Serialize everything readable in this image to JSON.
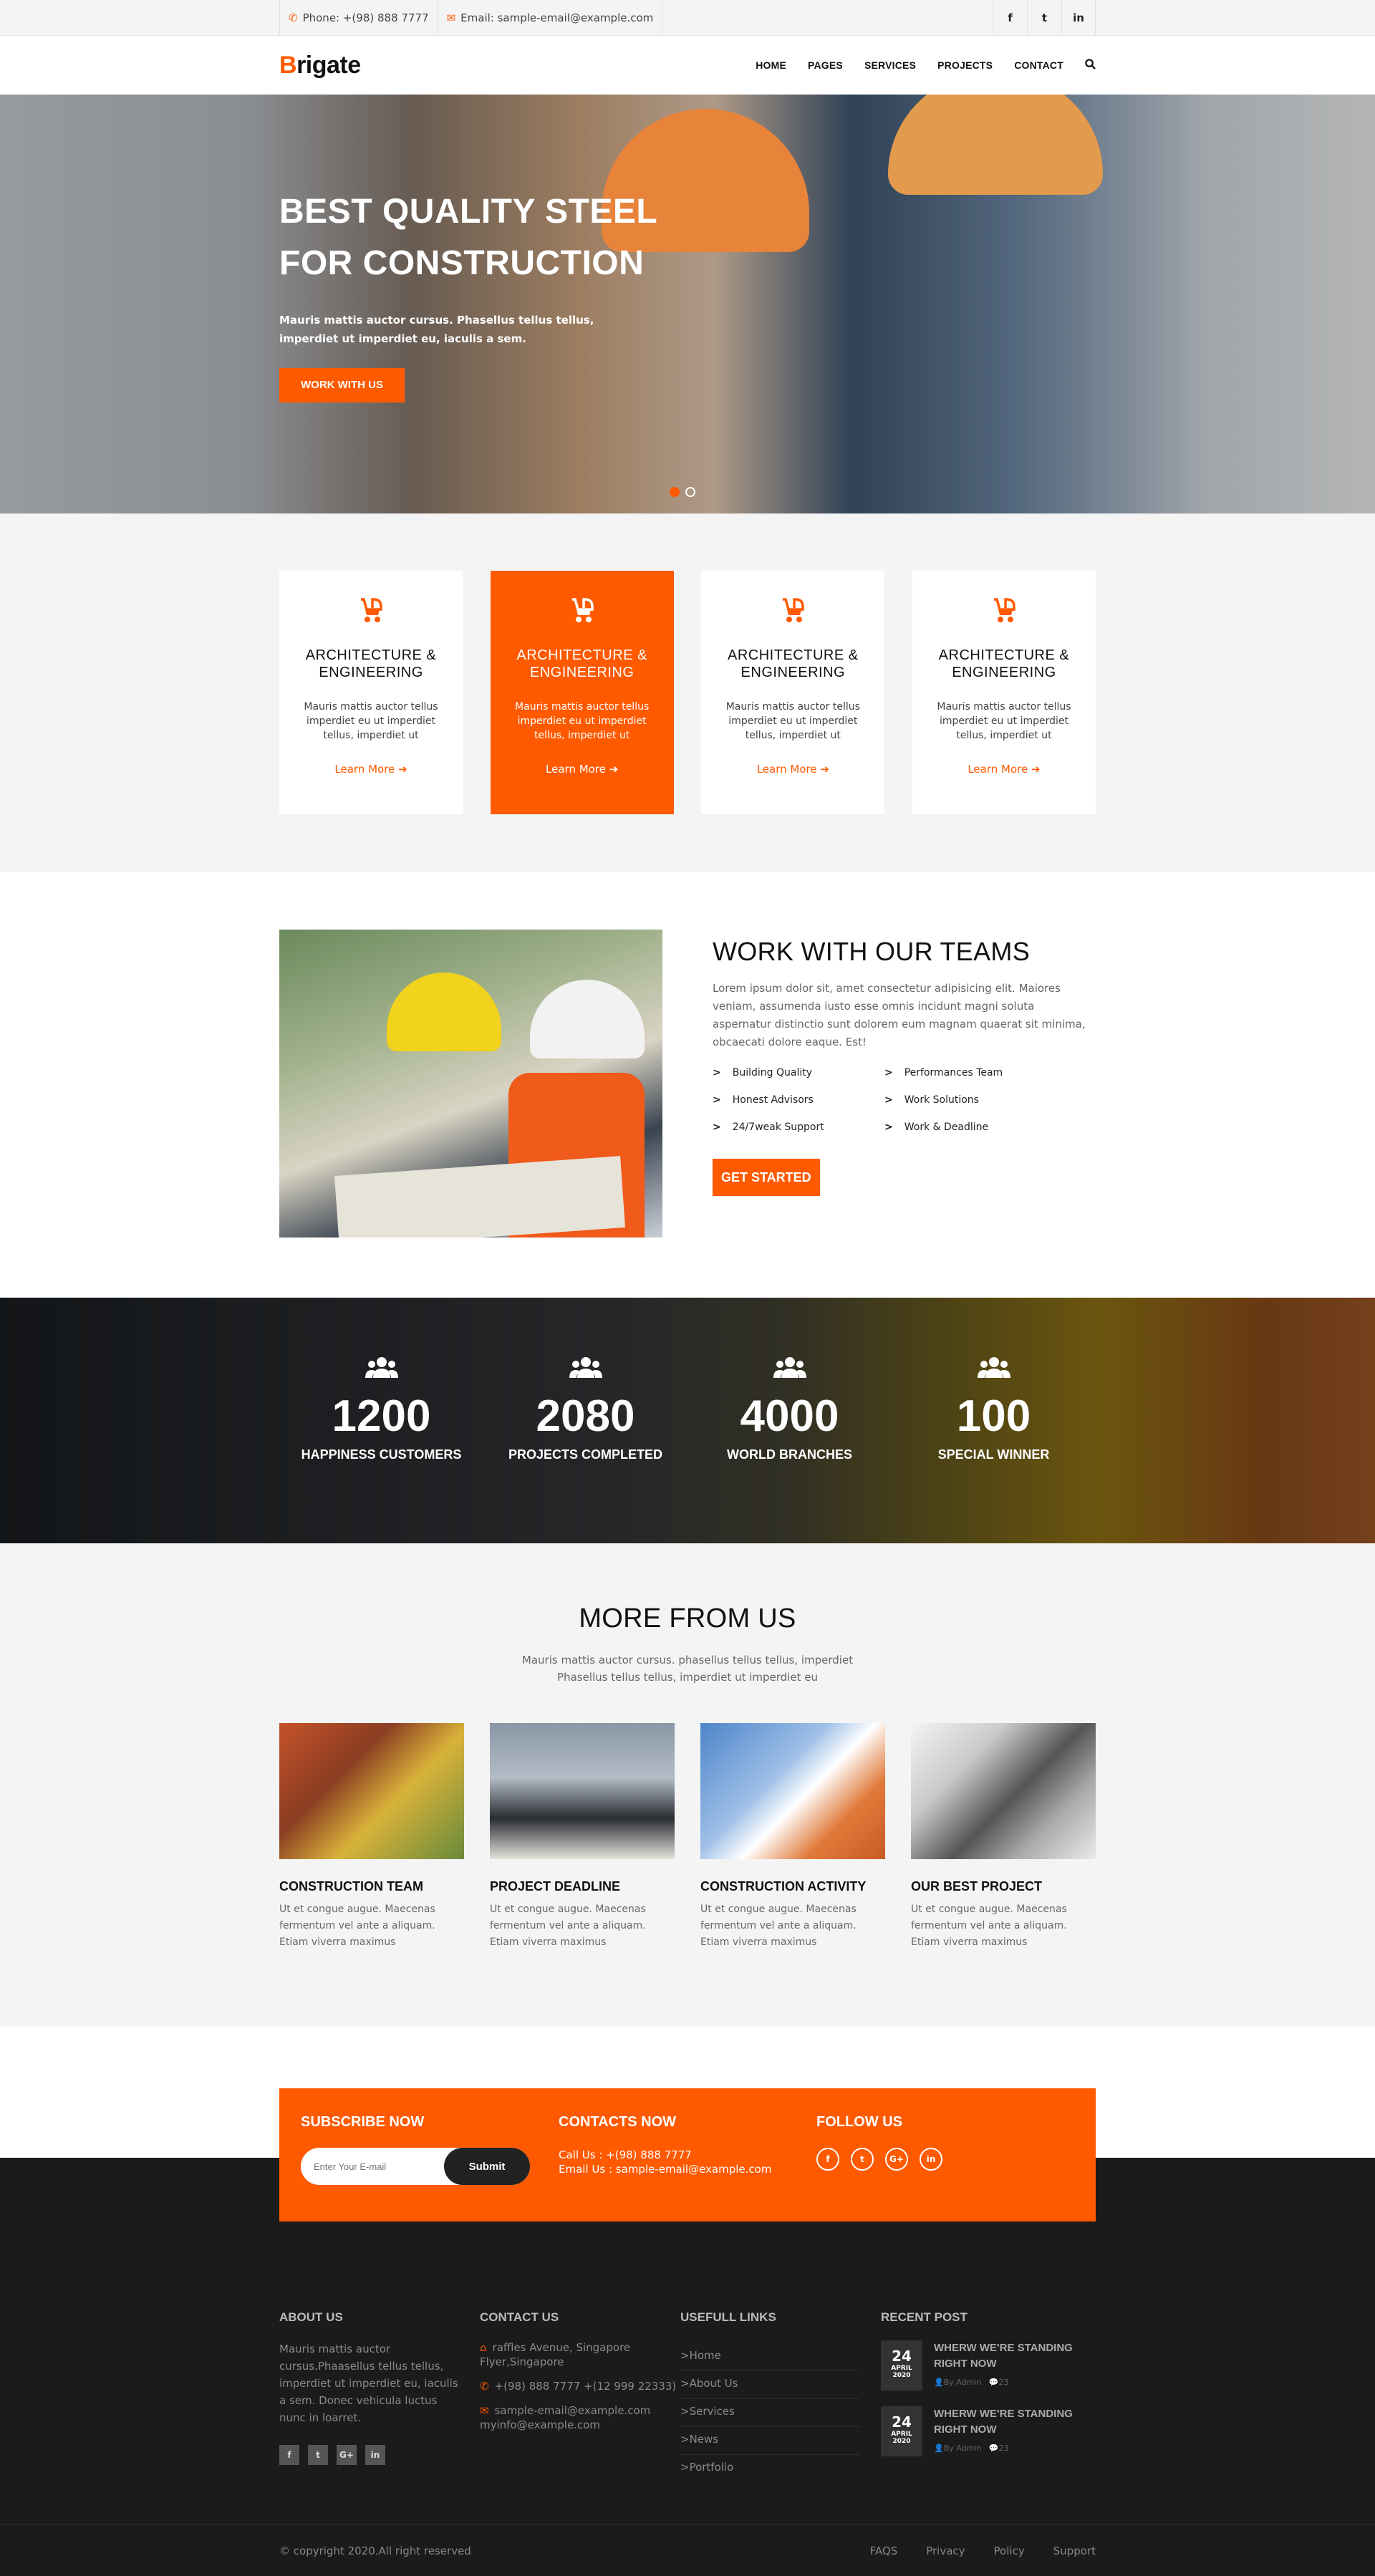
{
  "topbar": {
    "phone": "Phone: +(98) 888 7777",
    "email": "Email: sample-email@example.com",
    "socials": [
      "f",
      "t",
      "in"
    ]
  },
  "header": {
    "logo_first": "B",
    "logo_rest": "rigate",
    "nav": [
      "HOME",
      "PAGES",
      "SERVICES",
      "PROJECTS",
      "CONTACT"
    ]
  },
  "hero": {
    "title": "BEST QUALITY STEEL FOR CONSTRUCTION",
    "text": "Mauris mattis auctor cursus. Phasellus tellus tellus, imperdiet ut imperdiet eu, iaculis a sem.",
    "button": "WORK WITH US"
  },
  "services": [
    {
      "title": "ARCHITECTURE & ENGINEERING",
      "text": "Mauris mattis auctor tellus imperdiet eu ut imperdiet tellus, imperdiet ut",
      "link": "Learn More"
    },
    {
      "title": "ARCHITECTURE & ENGINEERING",
      "text": "Mauris mattis auctor tellus imperdiet eu ut imperdiet tellus, imperdiet ut",
      "link": "Learn More"
    },
    {
      "title": "ARCHITECTURE & ENGINEERING",
      "text": "Mauris mattis auctor tellus imperdiet eu ut imperdiet tellus, imperdiet ut",
      "link": "Learn More"
    },
    {
      "title": "ARCHITECTURE & ENGINEERING",
      "text": "Mauris mattis auctor tellus imperdiet eu ut imperdiet tellus, imperdiet ut",
      "link": "Learn More"
    }
  ],
  "team": {
    "title": "WORK WITH OUR TEAMS",
    "text": "Lorem ipsum dolor sit, amet consectetur adipisicing elit. Maiores veniam, assumenda iusto esse omnis incidunt magni soluta aspernatur distinctio sunt dolorem eum magnam quaerat sit minima, obcaecati dolore eaque. Est!",
    "items": [
      "Building Quality",
      "Performances Team",
      "Honest Advisors",
      "Work Solutions",
      "24/7weak Support",
      "Work & Deadline"
    ],
    "button": "GET STARTED"
  },
  "counters": [
    {
      "num": "1200",
      "label": "HAPPINESS CUSTOMERS"
    },
    {
      "num": "2080",
      "label": "PROJECTS COMPLETED"
    },
    {
      "num": "4000",
      "label": "WORLD BRANCHES"
    },
    {
      "num": "100",
      "label": "SPECIAL WINNER"
    }
  ],
  "more": {
    "title": "MORE FROM US",
    "subtitle": "Mauris mattis auctor cursus. phasellus tellus tellus, imperdiet Phasellus tellus tellus, imperdiet ut imperdiet eu",
    "posts": [
      {
        "title": "CONSTRUCTION TEAM",
        "text": "Ut et congue augue. Maecenas fermentum vel ante a aliquam. Etiam viverra maximus"
      },
      {
        "title": "PROJECT DEADLINE",
        "text": "Ut et congue augue. Maecenas fermentum vel ante a aliquam. Etiam viverra maximus"
      },
      {
        "title": "CONSTRUCTION ACTIVITY",
        "text": "Ut et congue augue. Maecenas fermentum vel ante a aliquam. Etiam viverra maximus"
      },
      {
        "title": "OUR BEST PROJECT",
        "text": "Ut et congue augue. Maecenas fermentum vel ante a aliquam. Etiam viverra maximus"
      }
    ]
  },
  "subscribe": {
    "title": "SUBSCRIBE NOW",
    "placeholder": "Enter Your E-mail",
    "button": "Submit",
    "contacts_title": "CONTACTS NOW",
    "call": "Call Us : +(98) 888 7777",
    "email": "Email Us : sample-email@example.com",
    "follow_title": "FOLLOW US",
    "follow": [
      "f",
      "t",
      "G+",
      "in"
    ]
  },
  "footer": {
    "about_title": "ABOUT US",
    "about_text": "Mauris mattis auctor cursus.Phaasellus tellus tellus, imperdiet ut imperdiet eu, iaculis a sem. Donec vehicula luctus nunc in loarret.",
    "about_socials": [
      "f",
      "t",
      "G+",
      "in"
    ],
    "contact_title": "CONTACT US",
    "address": "raffles Avenue, Singapore Flyer,Singapore",
    "phones": "+(98) 888 7777 +(12 999 22333)",
    "emails": "sample-email@example.com myinfo@example.com",
    "links_title": "USEFULL LINKS",
    "links": [
      ">Home",
      ">About Us",
      ">Services",
      ">News",
      ">Portfolio"
    ],
    "recent_title": "RECENT POST",
    "posts": [
      {
        "day": "24",
        "month": "APRIL",
        "year": "2020",
        "title": "WHERW WE'RE STANDING RIGHT NOW",
        "author": "By Admin",
        "comments": "23"
      },
      {
        "day": "24",
        "month": "APRIL",
        "year": "2020",
        "title": "WHERW WE'RE STANDING RIGHT NOW",
        "author": "By Admin",
        "comments": "23"
      }
    ],
    "copyright": "© copyright 2020.All right reserved",
    "bottom_links": [
      "FAQS",
      "Privacy",
      "Policy",
      "Support"
    ]
  }
}
